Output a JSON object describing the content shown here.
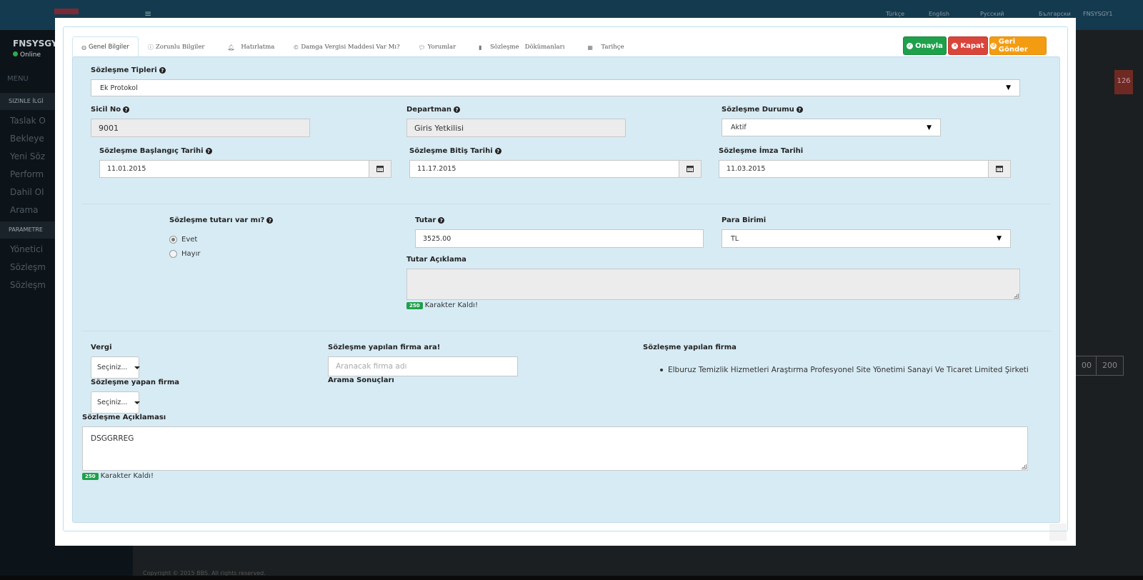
{
  "background": {
    "languages": [
      "Türkçe",
      "English",
      "Русский",
      "Български"
    ],
    "user": "FNSYSGY1",
    "sidebar_user": "FNSYSGY",
    "status": "Online",
    "menu_label": "MENU",
    "section1": "SIZINLE İLGİ",
    "items1": [
      "Taslak O",
      "Bekleye",
      "Yeni Söz",
      "Perform",
      "Dahil Ol",
      "Arama"
    ],
    "section2": "PARAMETRE",
    "items2": [
      "Yönetici",
      "Sözleşm",
      "Sözleşm"
    ],
    "badge": "126",
    "pager": [
      "00",
      "200"
    ],
    "footer": "Copyright © 2015 BBS. All rights reserved."
  },
  "actions": {
    "approve": "Onayla",
    "close": "Kapat",
    "return": "Geri Gönder"
  },
  "tabs": [
    {
      "label": "Genel Bilgiler",
      "icon": "globe-icon"
    },
    {
      "label": "Zorunlu Bilgiler",
      "icon": "info-icon"
    },
    {
      "label": "Hatırlatma",
      "icon": "bell-icon"
    },
    {
      "label": "Damga Vergisi Maddesi Var Mı?",
      "icon": "copyright-icon"
    },
    {
      "label": "Yorumlar",
      "icon": "comment-icon"
    },
    {
      "label": "Sözleşme   Dökümanları",
      "icon": "file-icon"
    },
    {
      "label": "Tarihçe",
      "icon": "calendar-icon"
    }
  ],
  "form": {
    "contract_type_label": "Sözleşme Tipleri",
    "contract_type_value": "Ek Protokol",
    "sicil_label": "Sicil No",
    "sicil_value": "9001",
    "department_label": "Departman",
    "department_value": "Giris Yetkilisi",
    "status_label": "Sözleşme Durumu",
    "status_value": "Aktif",
    "start_label": "Sözleşme Başlangıç Tarihi",
    "start_value": "11.01.2015",
    "end_label": "Sözleşme Bitiş Tarihi",
    "end_value": "11.17.2015",
    "sign_label": "Sözleşme İmza Tarihi",
    "sign_value": "11.03.2015",
    "has_amount_label": "Sözleşme tutarı var mı?",
    "yes_label": "Evet",
    "no_label": "Hayır",
    "amount_label": "Tutar",
    "amount_value": "3525.00",
    "currency_label": "Para Birimi",
    "currency_value": "TL",
    "amount_desc_label": "Tutar Açıklama",
    "amount_desc_counter": "250",
    "counter_text": "Karakter Kaldı!",
    "tax_label": "Vergi",
    "tax_value": "Seçiniz...",
    "signing_firm_label": "Sözleşme yapan firma",
    "signing_firm_value": "Seçiniz...",
    "firm_search_label": "Sözleşme yapılan firma ara!",
    "firm_search_placeholder": "Aranacak firma adı",
    "search_results_label": "Arama Sonuçları",
    "contracted_firm_label": "Sözleşme yapılan firma",
    "contracted_firm_item": "Elburuz Temizlik Hizmetleri Araştırma Profesyonel Site Yönetimi Sanayi Ve Ticaret Limited Şirketi",
    "description_label": "Sözleşme Açıklaması",
    "description_value": "DSGGRREG",
    "description_counter": "250"
  }
}
